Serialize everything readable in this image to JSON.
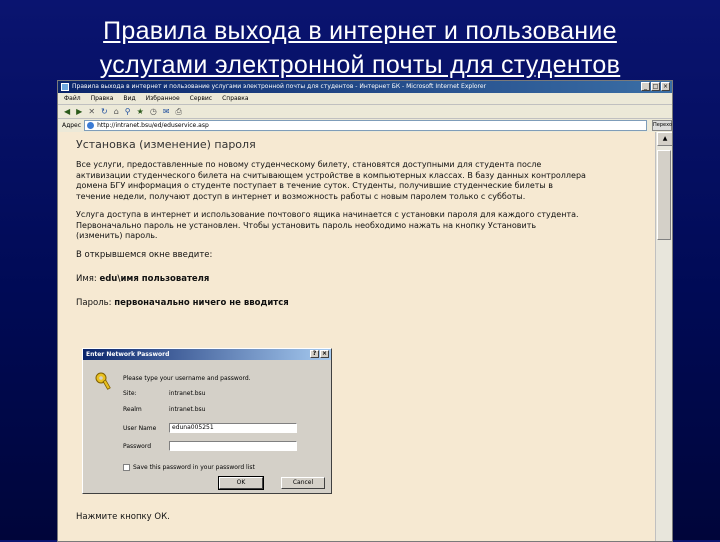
{
  "slide": {
    "title_line1": "Правила выхода в интернет и пользование",
    "title_line2": "услугами электронной почты для студентов"
  },
  "browser": {
    "window_title": "Правила выхода в интернет и пользование услугами электронной почты для студентов - Интернет БК - Microsoft Internet Explorer",
    "menu": [
      "Файл",
      "Правка",
      "Вид",
      "Избранное",
      "Сервис",
      "Справка"
    ],
    "address_label": "Адрес",
    "address_value": "http://intranet.bsu/ed/eduservice.asp",
    "go_label": "Переход"
  },
  "page": {
    "heading": "Установка (изменение) пароля",
    "paragraph1": [
      "Все услуги, предоставленные по новому студенческому билету, становятся доступными для студента после",
      "активизации студенческого билета на считывающем устройстве в компьютерных классах. В базу данных контроллера",
      "домена БГУ информация о студенте поступает в течение суток. Студенты, получившие студенческие билеты в",
      "течение недели, получают доступ в интернет и возможность работы с новым паролем только с субботы."
    ],
    "paragraph2": [
      "Услуга доступа в интернет и использование почтового ящика начинается с установки пароля для каждого студента.",
      "Первоначально пароль не установлен. Чтобы установить пароль необходимо нажать на кнопку Установить",
      "(изменить) пароль."
    ],
    "prompt_line": "В открывшемся окне введите:",
    "name_label": "Имя: ",
    "name_value": "edu\\имя пользователя",
    "password_label": "Пароль: ",
    "password_value": "первоначально ничего не вводится",
    "footer": "Нажмите кнопку ОК."
  },
  "dialog": {
    "title": "Enter Network Password",
    "prompt": "Please type your username and password.",
    "site_label": "Site:",
    "site_value": "intranet.bsu",
    "realm_label": "Realm",
    "realm_value": "intranet.bsu",
    "username_label": "User Name",
    "username_value": "eduna005251",
    "password_label": "Password",
    "password_value": "",
    "checkbox_label": "Save this password in your password list",
    "ok_label": "OK",
    "cancel_label": "Cancel"
  }
}
